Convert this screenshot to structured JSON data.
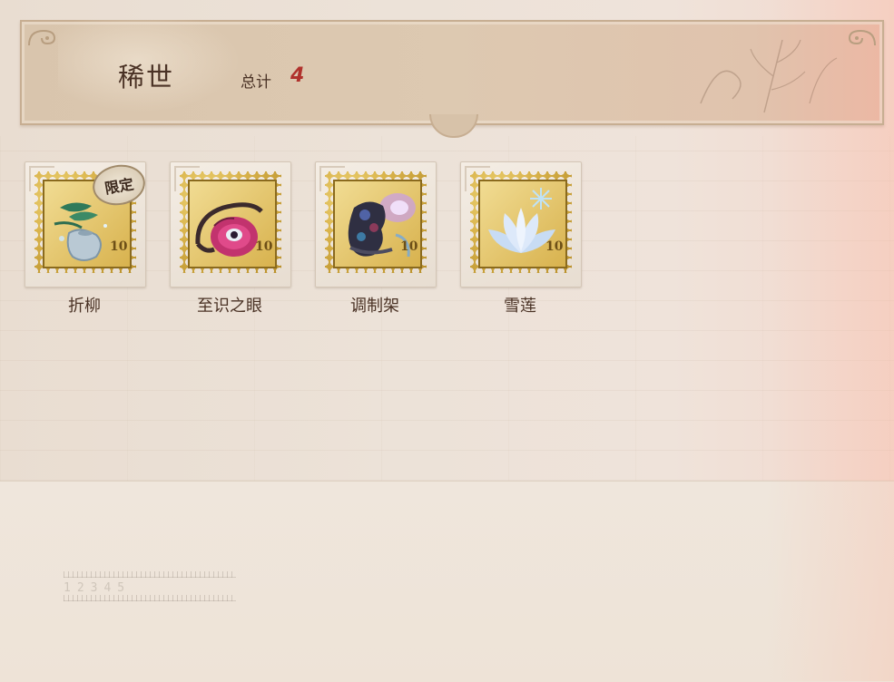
{
  "header": {
    "title": "稀世",
    "total_label": "总计",
    "total_value": "4"
  },
  "items": [
    {
      "name": "折柳",
      "badge": "限定",
      "stamp_value": "10",
      "icon": "willow-vase-icon"
    },
    {
      "name": "至识之眼",
      "badge": "",
      "stamp_value": "10",
      "icon": "eye-of-knowledge-icon"
    },
    {
      "name": "调制架",
      "badge": "",
      "stamp_value": "10",
      "icon": "blending-rack-icon"
    },
    {
      "name": "雪莲",
      "badge": "",
      "stamp_value": "10",
      "icon": "snow-lotus-icon"
    }
  ],
  "colors": {
    "accent_value": "#b0312c",
    "stamp_gold": "#d8b24a",
    "text_brown": "#4a3225"
  }
}
